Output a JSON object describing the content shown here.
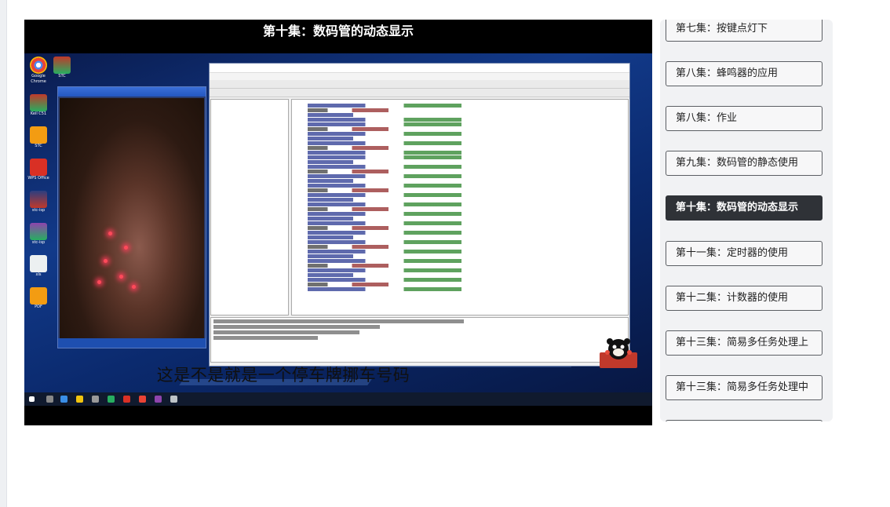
{
  "video": {
    "title": "第十集：数码管的动态显示",
    "subtitle": "这是不是就是一个停车牌挪车号码"
  },
  "playlist": {
    "episodes": [
      {
        "label": "第七集：按键点灯下",
        "active": false
      },
      {
        "label": "第八集：蜂鸣器的应用",
        "active": false
      },
      {
        "label": "第八集：作业",
        "active": false
      },
      {
        "label": "第九集：数码管的静态使用",
        "active": false
      },
      {
        "label": "第十集：数码管的动态显示",
        "active": true
      },
      {
        "label": "第十一集：定时器的使用",
        "active": false
      },
      {
        "label": "第十二集：计数器的使用",
        "active": false
      },
      {
        "label": "第十三集：简易多任务处理上",
        "active": false
      },
      {
        "label": "第十三集：简易多任务处理中",
        "active": false
      }
    ]
  },
  "colors": {
    "active_bg": "#2f3237",
    "desktop_blue": "#123a8a"
  }
}
